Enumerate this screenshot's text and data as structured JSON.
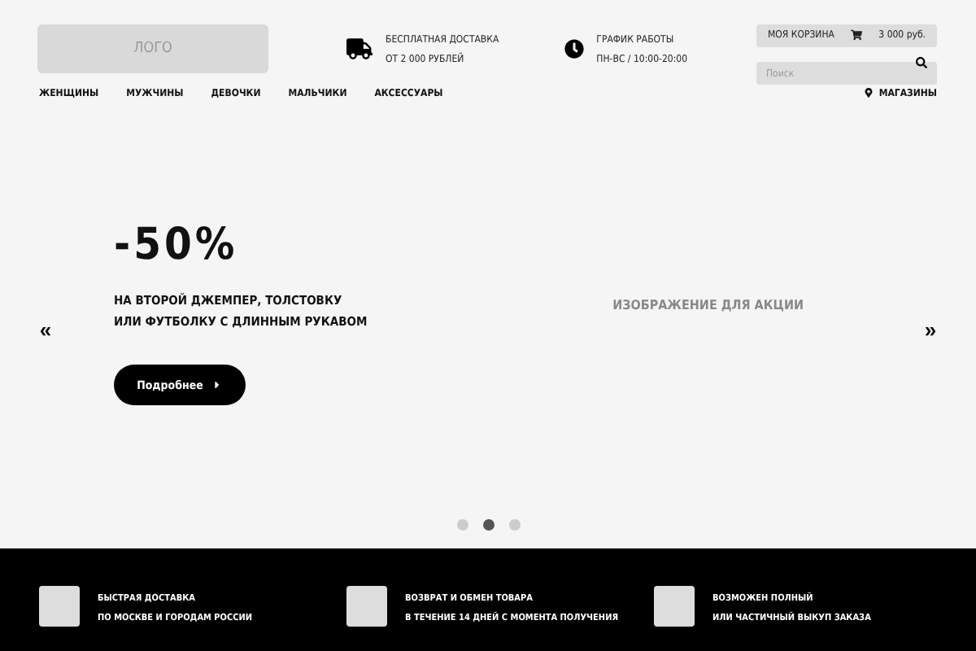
{
  "header": {
    "logo": "ЛОГО",
    "delivery": {
      "title": "БЕСПЛАТНАЯ ДОСТАВКА",
      "subtitle": "ОТ 2 000 РУБЛЕЙ"
    },
    "schedule": {
      "title": "ГРАФИК РАБОТЫ",
      "subtitle": "ПН-ВС / 10:00-20:00"
    },
    "cart": {
      "label": "МОЯ КОРЗИНА",
      "total": "3 000 руб."
    },
    "search": {
      "placeholder": "Поиск"
    }
  },
  "nav": {
    "items": [
      "ЖЕНЩИНЫ",
      "МУЖЧИНЫ",
      "ДЕВОЧКИ",
      "МАЛЬЧИКИ",
      "АКСЕССУАРЫ"
    ],
    "stores": "МАГАЗИНЫ"
  },
  "slider": {
    "prev": "«",
    "next": "»",
    "headline": "-50%",
    "text": "НА ВТОРОЙ ДЖЕМПЕР, ТОЛСТОВКУ\nИЛИ ФУТБОЛКУ С ДЛИННЫМ РУКАВОМ",
    "button": "Подробнее",
    "image_label": "ИЗОБРАЖЕНИЕ ДЛЯ АКЦИИ",
    "dots": [
      {
        "selected": false
      },
      {
        "selected": true
      },
      {
        "selected": false
      }
    ]
  },
  "features": [
    {
      "line1": "БЫСТРАЯ ДОСТАВКА",
      "line2": "ПО МОСКВЕ И ГОРОДАМ РОССИИ"
    },
    {
      "line1": "ВОЗВРАТ И ОБМЕН ТОВАРА",
      "line2": "В ТЕЧЕНИЕ 14 ДНЕЙ С МОМЕНТА ПОЛУЧЕНИЯ"
    },
    {
      "line1": "ВОЗМОЖЕН ПОЛНЫЙ",
      "line2": "ИЛИ ЧАСТИЧНЫЙ ВЫКУП ЗАКАЗА"
    }
  ]
}
